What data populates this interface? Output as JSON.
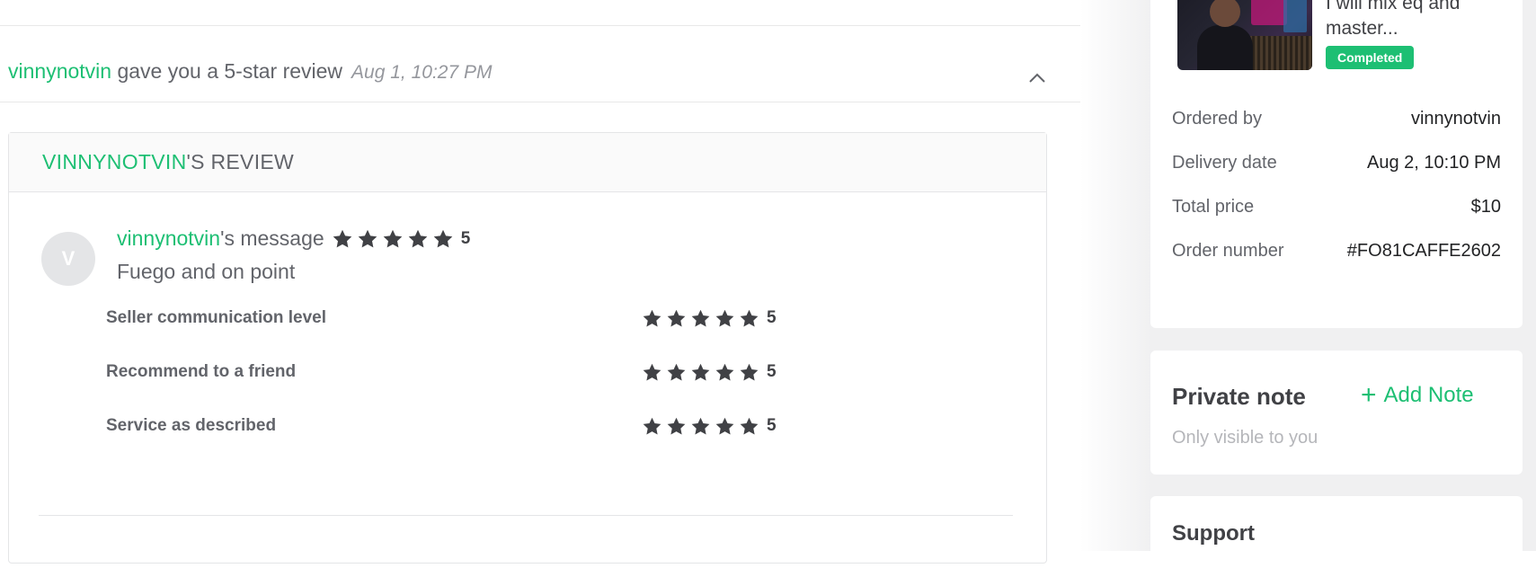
{
  "activity": {
    "username": "vinnynotvin",
    "text": " gave you a 5-star review",
    "timestamp": "Aug 1, 10:27 PM"
  },
  "review": {
    "header_username": "VINNYNOTVIN",
    "header_suffix": "'S REVIEW",
    "avatar_initial": "V",
    "message_username": "vinnynotvin",
    "message_suffix": "'s message",
    "message_rating": "5",
    "message_text": "Fuego and on point",
    "ratings": [
      {
        "label": "Seller communication level",
        "score": "5"
      },
      {
        "label": "Recommend to a friend",
        "score": "5"
      },
      {
        "label": "Service as described",
        "score": "5"
      }
    ],
    "star_color": "#404145"
  },
  "order": {
    "gig_title": "I will mix eq and master...",
    "status_badge": "Completed",
    "rows": [
      {
        "key": "Ordered by",
        "value": "vinnynotvin"
      },
      {
        "key": "Delivery date",
        "value": "Aug 2, 10:10 PM"
      },
      {
        "key": "Total price",
        "value": "$10"
      },
      {
        "key": "Order number",
        "value": "#FO81CAFFE2602"
      }
    ]
  },
  "private_note": {
    "title": "Private note",
    "add_label": "Add Note",
    "subtitle": "Only visible to you"
  },
  "support": {
    "title": "Support"
  },
  "colors": {
    "accent": "#1dbf73",
    "text": "#404145",
    "muted": "#62646a"
  },
  "icons": {
    "chevron": "chevron-up-icon",
    "star": "star-icon",
    "plus": "plus-icon"
  }
}
